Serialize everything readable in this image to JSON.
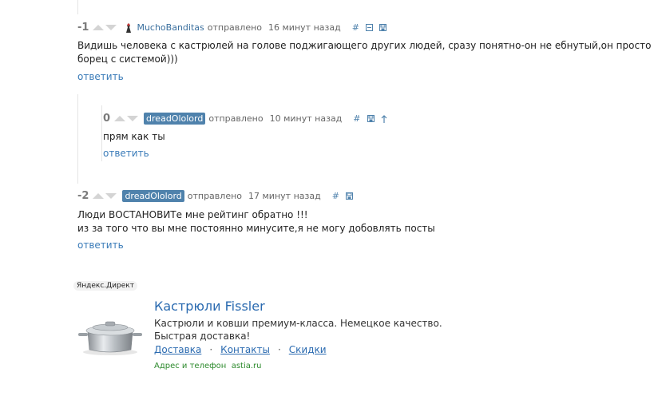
{
  "comments": [
    {
      "rating": "-1",
      "user": "MuchoBanditas",
      "sent": "отправлено",
      "time": "16 минут назад",
      "controls": [
        "#",
        "collapse",
        "save"
      ],
      "lines": [
        "Видишь человека с кастрюлей на голове поджигающего других людей, сразу понятно-он не ебнутый,он просто",
        "борец с системой)))"
      ],
      "reply": "ответить"
    },
    {
      "rating": "0",
      "user": "dreadOlolord",
      "sent": "отправлено",
      "time": "10 минут назад",
      "controls": [
        "#",
        "save",
        "parent"
      ],
      "lines": [
        "прям как ты"
      ],
      "reply": "ответить"
    },
    {
      "rating": "-2",
      "user": "dreadOlolord",
      "sent": "отправлено",
      "time": "17 минут назад",
      "controls": [
        "#",
        "save"
      ],
      "lines": [
        "Люди ВОСТАНОВИТе мне рейтинг обратно !!!",
        "из за того что вы мне постоянно минусите,я не могу добовлять посты"
      ],
      "reply": "ответить"
    }
  ],
  "ad": {
    "label": "Яндекс.Директ",
    "title": "Кастрюли Fissler",
    "desc": "Кастрюли и ковши премиум-класса. Немецкое качество. Быстрая доставка!",
    "links": [
      "Доставка",
      "Контакты",
      "Скидки"
    ],
    "address": "Адрес и телефон  astia.ru"
  }
}
